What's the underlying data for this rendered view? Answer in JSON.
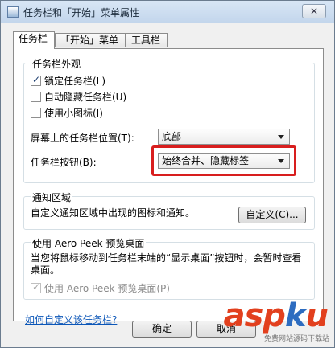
{
  "window": {
    "title": "任务栏和「开始」菜单属性",
    "close_glyph": "✕"
  },
  "tabs": [
    {
      "label": "任务栏",
      "active": true
    },
    {
      "label": "「开始」菜单",
      "active": false
    },
    {
      "label": "工具栏",
      "active": false
    }
  ],
  "appearance": {
    "group_title": "任务栏外观",
    "lock_taskbar": {
      "label": "锁定任务栏(L)",
      "checked": true
    },
    "auto_hide": {
      "label": "自动隐藏任务栏(U)",
      "checked": false
    },
    "small_icons": {
      "label": "使用小图标(I)",
      "checked": false
    },
    "location_label": "屏幕上的任务栏位置(T):",
    "location_value": "底部",
    "buttons_label": "任务栏按钮(B):",
    "buttons_value": "始终合并、隐藏标签"
  },
  "notification": {
    "group_title": "通知区域",
    "description": "自定义通知区域中出现的图标和通知。",
    "customize_button": "自定义(C)..."
  },
  "aero_peek": {
    "group_title": "使用 Aero Peek 预览桌面",
    "description": "当您将鼠标移动到任务栏末端的“显示桌面”按钮时，会暂时查看桌面。",
    "checkbox": {
      "label": "使用 Aero Peek 预览桌面(P)",
      "checked": true,
      "disabled": true
    }
  },
  "help_link": "如何自定义该任务栏?",
  "footer": {
    "ok_button": "确定",
    "other_button": "取消"
  },
  "watermark": {
    "brand_main": "asp",
    "brand_dot": "k",
    "brand_end": "u",
    "sub": "免费网站源码下载站"
  },
  "colors": {
    "highlight": "#d81e1e",
    "link": "#0b56b8"
  }
}
